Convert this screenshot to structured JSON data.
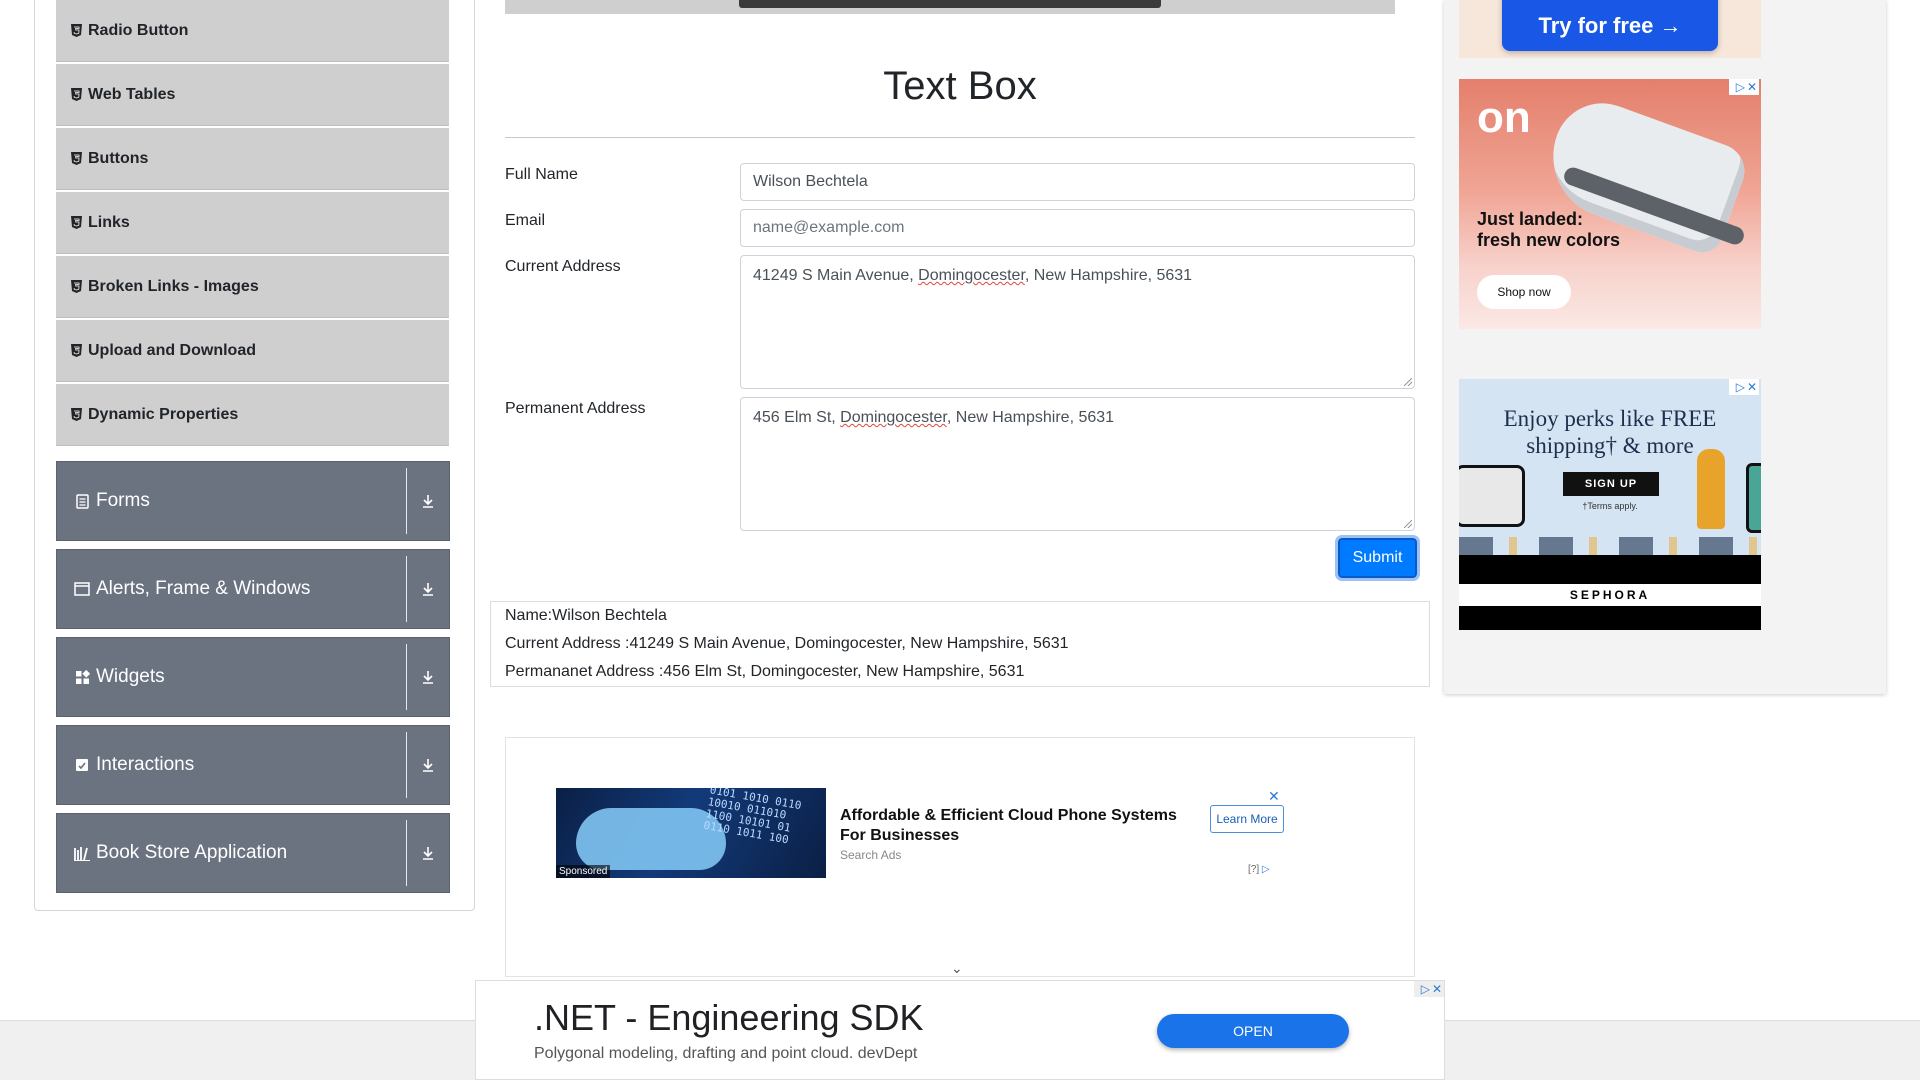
{
  "sidebar": {
    "sub_items": [
      {
        "label": "Radio Button"
      },
      {
        "label": "Web Tables"
      },
      {
        "label": "Buttons"
      },
      {
        "label": "Links"
      },
      {
        "label": "Broken Links - Images"
      },
      {
        "label": "Upload and Download"
      },
      {
        "label": "Dynamic Properties"
      }
    ],
    "groups": [
      {
        "label": "Forms",
        "icon": "form-icon"
      },
      {
        "label": "Alerts, Frame & Windows",
        "icon": "window-icon"
      },
      {
        "label": "Widgets",
        "icon": "widgets-icon"
      },
      {
        "label": "Interactions",
        "icon": "interactions-icon"
      },
      {
        "label": "Book Store Application",
        "icon": "library-icon"
      }
    ]
  },
  "main": {
    "title": "Text Box",
    "form": {
      "full_name_label": "Full Name",
      "full_name_value": "Wilson Bechtela",
      "email_label": "Email",
      "email_placeholder": "name@example.com",
      "current_address_label": "Current Address",
      "current_address_value": {
        "pre": "41249 S Main Avenue, ",
        "city": "Domingocester",
        "post": ", New Hampshire, 5631"
      },
      "permanent_address_label": "Permanent Address",
      "permanent_address_value": {
        "pre": "456 Elm St, ",
        "city": "Domingocester",
        "post": ", New Hampshire, 5631"
      },
      "submit_label": "Submit"
    },
    "output": {
      "name_line": "Name:Wilson Bechtela",
      "current_line": "Current Address :41249 S Main Avenue, Domingocester, New Hampshire, 5631",
      "permanent_line": "Permananet Address :456 Elm St, Domingocester, New Hampshire, 5631"
    }
  },
  "ads": {
    "cloud": {
      "headline": "Affordable & Efficient Cloud Phone Systems For Businesses",
      "source": "Search Ads",
      "button": "Learn More",
      "sponsored": "Sponsored",
      "info": "[?]",
      "digits": "0101 1010 0110\n10010 011010\n1100 10101 01\n0110 1011 100"
    },
    "try": {
      "label": "Try for free →"
    },
    "shoe": {
      "logo": "on",
      "text": "Just landed:\nfresh new colors",
      "button": "Shop now"
    },
    "sephora": {
      "headline": "Enjoy perks like FREE shipping† & more",
      "signup": "SIGN UP",
      "terms": "†Terms apply.",
      "brand": "SEPHORA"
    },
    "bottom": {
      "title": ".NET - Engineering SDK",
      "subtitle": "Polygonal modeling, drafting and point cloud. devDept",
      "button": "OPEN"
    }
  }
}
